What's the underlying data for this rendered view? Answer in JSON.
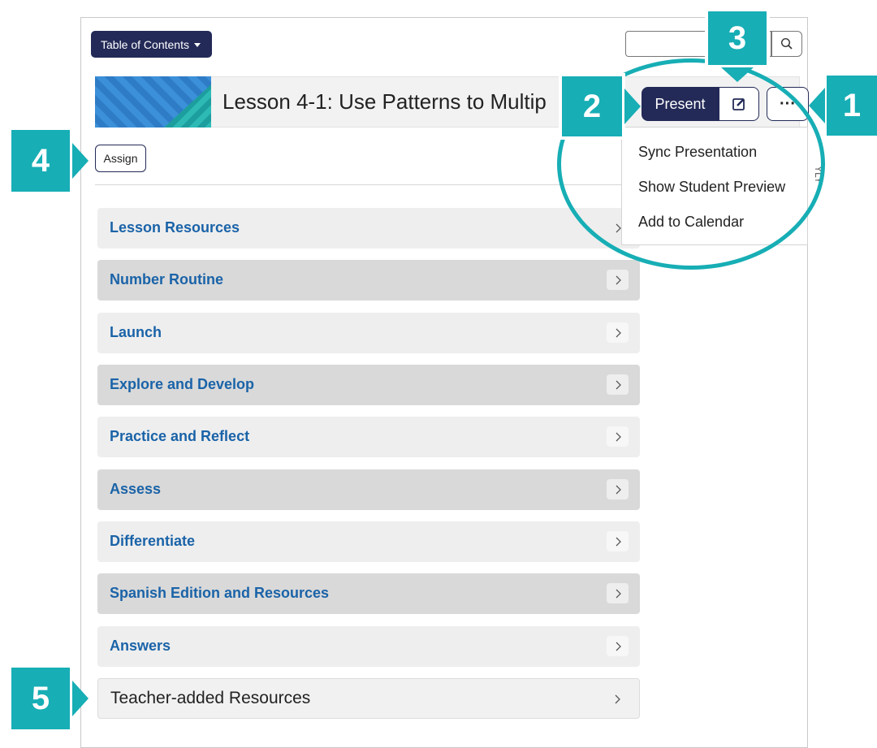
{
  "toolbar": {
    "toc_label": "Table of Contents",
    "search_placeholder": ""
  },
  "lesson": {
    "title": "Lesson 4-1: Use Patterns to Multip"
  },
  "actions": {
    "present_label": "Present",
    "more_label": "···",
    "assign_label": "Assign"
  },
  "menu": {
    "items": [
      "Sync Presentation",
      "Show Student Preview",
      "Add to Calendar"
    ]
  },
  "sections": [
    {
      "label": "Lesson Resources"
    },
    {
      "label": "Number Routine"
    },
    {
      "label": "Launch"
    },
    {
      "label": "Explore and Develop"
    },
    {
      "label": "Practice and Reflect"
    },
    {
      "label": "Assess"
    },
    {
      "label": "Differentiate"
    },
    {
      "label": "Spanish Edition and Resources"
    },
    {
      "label": "Answers"
    },
    {
      "label": "Teacher-added Resources"
    }
  ],
  "callouts": {
    "c1": "1",
    "c2": "2",
    "c3": "3",
    "c4": "4",
    "c5": "5"
  },
  "colors": {
    "navy": "#232a57",
    "teal": "#17aeb5",
    "link_blue": "#1a63a8"
  },
  "icons": {
    "search": "search-icon",
    "edit": "edit-icon",
    "chevron": "chevron-right-icon",
    "caret": "caret-down-icon"
  }
}
